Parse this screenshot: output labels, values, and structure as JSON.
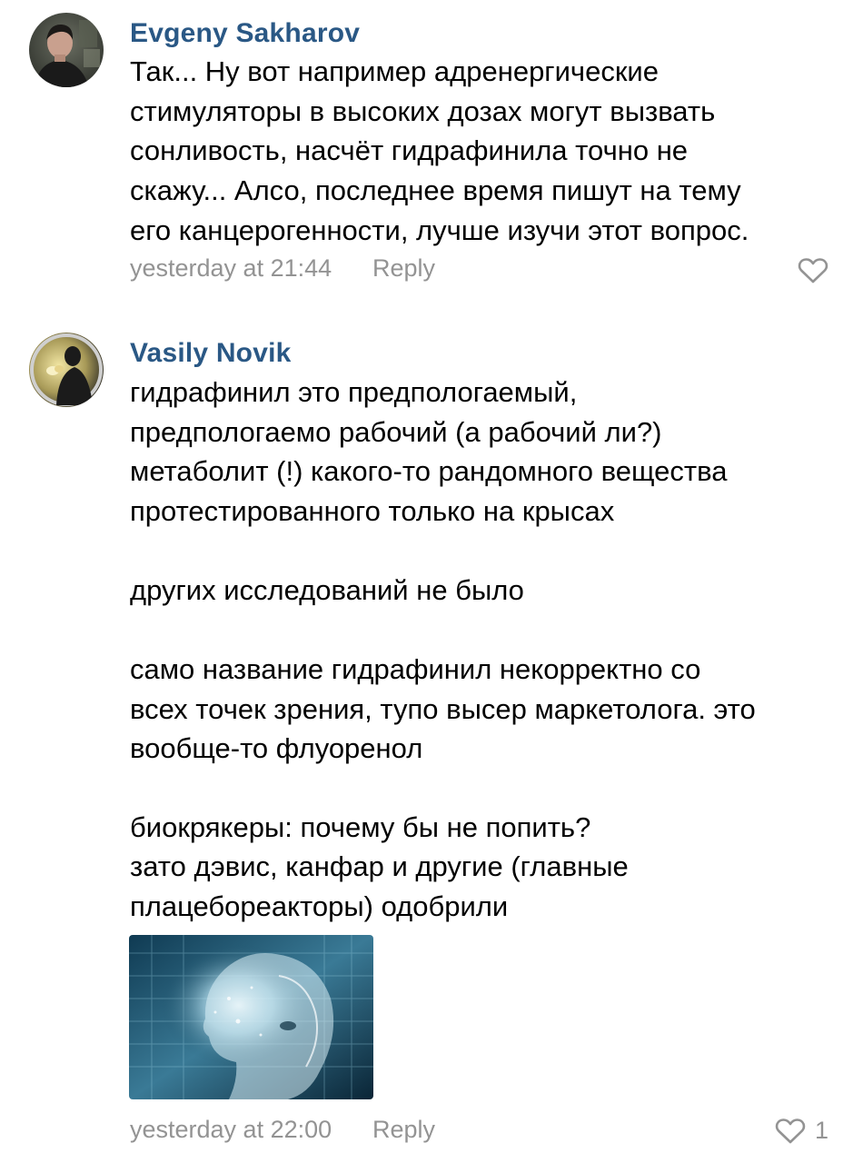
{
  "comments": [
    {
      "author": "Evgeny Sakharov",
      "lines": [
        "Так... Ну вот например адренергические",
        "стимуляторы в высоких дозах могут вызвать",
        "сонливость, насчёт гидрафинила точно не",
        "скажу... Алсо, последнее время пишут на тему",
        "его канцерогенности, лучше изучи этот вопрос."
      ],
      "time": "yesterday at 21:44",
      "reply": "Reply",
      "likes": "",
      "avatar_icon": "user-photo-avatar",
      "like_icon": "heart-icon"
    },
    {
      "author": "Vasily Novik",
      "lines": [
        "гидрафинил это предпологаемый,",
        "предпологаемо рабочий (а рабочий ли?)",
        "метаболит (!) какого-то рандомного вещества",
        "протестированного только на крысах",
        "",
        "других исследований не было",
        "",
        "само название гидрафинил некорректно со",
        "всех точек зрения, тупо высер маркетолога. это",
        "вообще-то флуоренол",
        "",
        "биокрякеры: почему бы не попить?",
        "зато дэвис, канфар и другие (главные",
        "плацебореакторы) одобрили"
      ],
      "time": "yesterday at 22:00",
      "reply": "Reply",
      "likes": "1",
      "avatar_icon": "user-photo-avatar",
      "like_icon": "heart-icon",
      "attachment_icon": "digital-head-image"
    }
  ],
  "colors": {
    "author": "#2a5885",
    "meta": "#939393",
    "text": "#000000",
    "background": "#ffffff"
  }
}
